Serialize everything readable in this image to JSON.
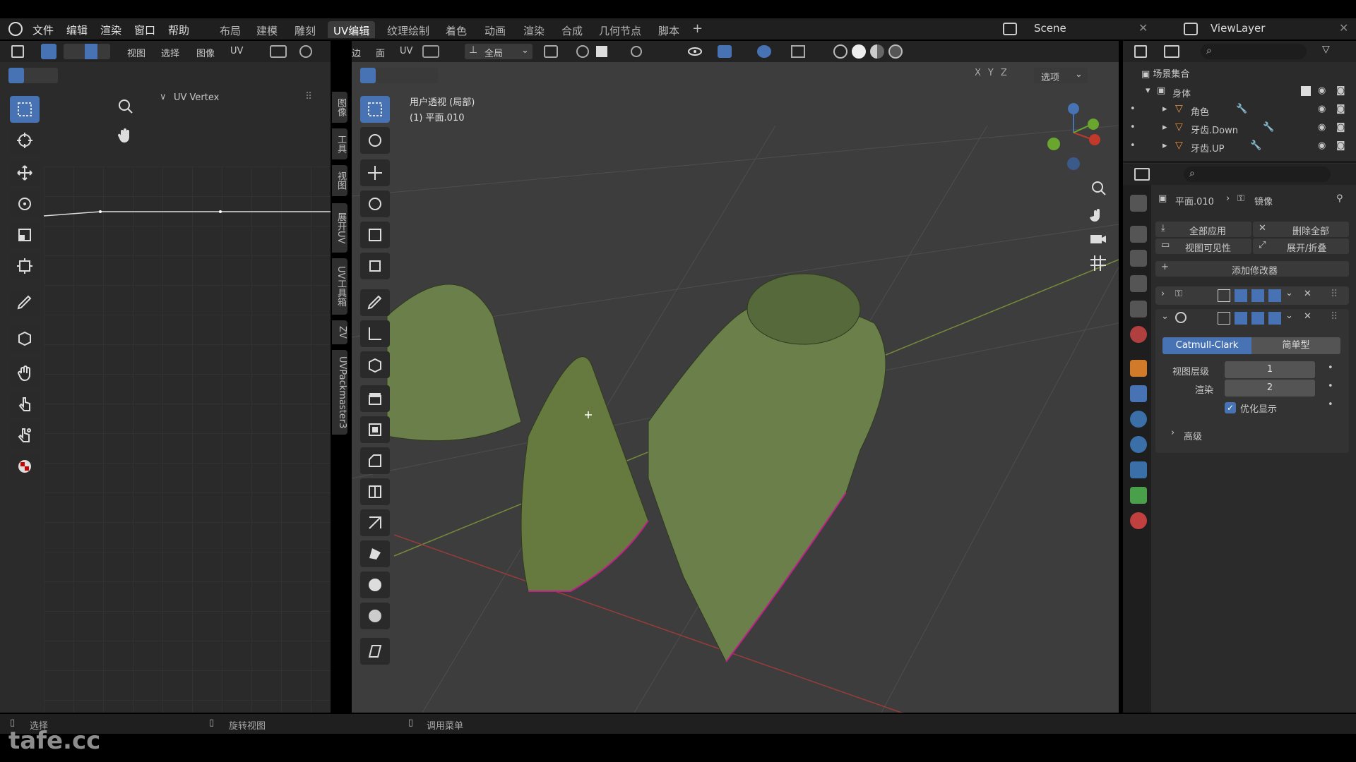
{
  "menu": [
    "文件",
    "编辑",
    "渲染",
    "窗口",
    "帮助"
  ],
  "workspaces": [
    "布局",
    "建模",
    "雕刻",
    "UV编辑",
    "纹理绘制",
    "着色",
    "动画",
    "渲染",
    "合成",
    "几何节点",
    "脚本"
  ],
  "active_workspace": "UV编辑",
  "scene": "Scene",
  "view_layer": "ViewLayer",
  "uv_header": {
    "view": "视图",
    "select": "选择",
    "image": "图像",
    "uv": "UV"
  },
  "uv_panel_title": "UV Vertex",
  "uv_vertical_tabs": [
    "图像",
    "工具",
    "视图",
    "展开UV",
    "UV工具箱",
    "ZV",
    "UVPackmaster3"
  ],
  "vp_header": {
    "edge": "边",
    "face": "面",
    "uv": "UV",
    "orientation": "全局",
    "options": "选项",
    "x": "X",
    "y": "Y",
    "z": "Z"
  },
  "viewport": {
    "line1": "用户透视 (局部)",
    "line2": "(1) 平面.010"
  },
  "outliner": {
    "collection": "场景集合",
    "items": [
      {
        "name": "身体"
      },
      {
        "name": "角色"
      },
      {
        "name": "牙齿.Down"
      },
      {
        "name": "牙齿.UP"
      }
    ]
  },
  "properties": {
    "object": "平面.010",
    "modifier_crumb": "镜像",
    "apply_all": "全部应用",
    "delete_all": "删除全部",
    "viewport_vis": "视图可见性",
    "expand": "展开/折叠",
    "add_modifier": "添加修改器",
    "subdiv_type_a": "Catmull-Clark",
    "subdiv_type_b": "简单型",
    "levels_label": "视图层级",
    "levels_value": "1",
    "render_label": "渲染",
    "render_value": "2",
    "optimize": "优化显示",
    "advanced": "高级"
  },
  "status": {
    "select": "选择",
    "rotate": "旋转视图",
    "menu": "调用菜单"
  },
  "watermark": "tafe.cc",
  "colors": {
    "accent": "#4772b3",
    "mesh": "#6b7f4a",
    "seam": "#c0208a"
  }
}
